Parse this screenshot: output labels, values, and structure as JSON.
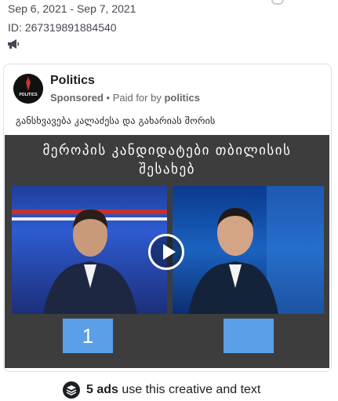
{
  "meta": {
    "date_range": "Sep 6, 2021 - Sep 7, 2021",
    "ad_id": "ID: 267319891884540"
  },
  "icons": {
    "platform": "megaphone-icon",
    "stack": "layers-icon",
    "play": "play-icon"
  },
  "ad": {
    "page_name": "Politics",
    "sponsored": "Sponsored",
    "separator": " • ",
    "paid_for_prefix": "Paid for by ",
    "paid_for_name": "politics",
    "body_text": "განსხვავება კალაძესა და გახარიას შორის",
    "avatar_text": "POLITICS"
  },
  "media": {
    "title_line1": "მეროპის კანდიდატები თბილისის",
    "title_line2": "შესახებ",
    "box_left_label": "1",
    "box_right_label": ""
  },
  "footer": {
    "count": "5 ads",
    "text": " use this creative and text"
  },
  "colors": {
    "accent_blue": "#5a9fe8",
    "media_background": "#3d3d3d"
  }
}
